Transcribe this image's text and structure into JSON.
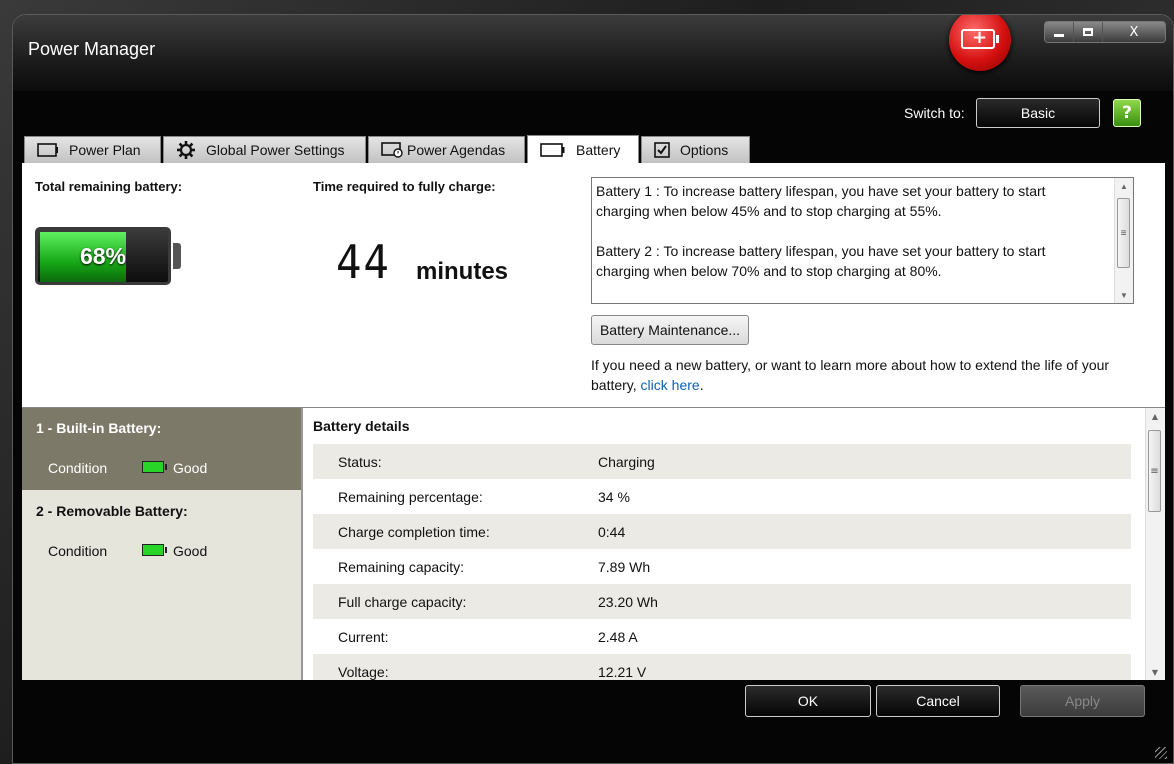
{
  "window": {
    "title": "Power Manager",
    "minimize_icon": "minimize-icon",
    "maximize_icon": "maximize-icon",
    "close_label": "X"
  },
  "header": {
    "switch_label": "Switch to:",
    "switch_button": "Basic",
    "help_icon": "help-icon"
  },
  "tabs": [
    {
      "label": "Power Plan",
      "icon": "battery-outline-icon",
      "active": false
    },
    {
      "label": "Global Power Settings",
      "icon": "gear-icon",
      "active": false
    },
    {
      "label": "Power Agendas",
      "icon": "calendar-clock-icon",
      "active": false
    },
    {
      "label": "Battery",
      "icon": "battery-icon",
      "active": true
    },
    {
      "label": "Options",
      "icon": "checkbox-icon",
      "active": false
    }
  ],
  "summary": {
    "remaining_label": "Total remaining battery:",
    "remaining_percent_text": "68%",
    "remaining_fraction": 0.68,
    "charge_time_label": "Time required to fully charge:",
    "charge_time_value": "44",
    "charge_time_unit": "minutes"
  },
  "info": {
    "battery1": "Battery 1 : To increase battery lifespan, you have set your battery to start charging when below 45% and to stop charging at 55%.",
    "battery2": "Battery 2 : To increase battery lifespan, you have set your battery to start charging when below 70% and to stop charging at 80%."
  },
  "maintenance_button": "Battery Maintenance...",
  "help": {
    "text": "If you need a new battery, or want to learn more about how to extend the life of your battery,",
    "link": "click here",
    "end": "."
  },
  "batteries": [
    {
      "title": "1 - Built-in Battery:",
      "condition_label": "Condition",
      "condition": "Good",
      "selected": true
    },
    {
      "title": "2 - Removable Battery:",
      "condition_label": "Condition",
      "condition": "Good",
      "selected": false
    }
  ],
  "details": {
    "title": "Battery details",
    "rows": [
      {
        "key": "Status:",
        "value": "Charging"
      },
      {
        "key": "Remaining percentage:",
        "value": "34 %"
      },
      {
        "key": "Charge completion time:",
        "value": "0:44"
      },
      {
        "key": "Remaining capacity:",
        "value": "7.89 Wh"
      },
      {
        "key": "Full charge capacity:",
        "value": "23.20 Wh"
      },
      {
        "key": "Current:",
        "value": "2.48 A"
      },
      {
        "key": "Voltage:",
        "value": "12.21 V"
      }
    ]
  },
  "buttons": {
    "ok": "OK",
    "cancel": "Cancel",
    "apply": "Apply"
  },
  "colors": {
    "accent_red": "#d51010",
    "battery_green": "#27d427",
    "link_blue": "#1060b0",
    "selected_sidebar": "#7d7968"
  }
}
